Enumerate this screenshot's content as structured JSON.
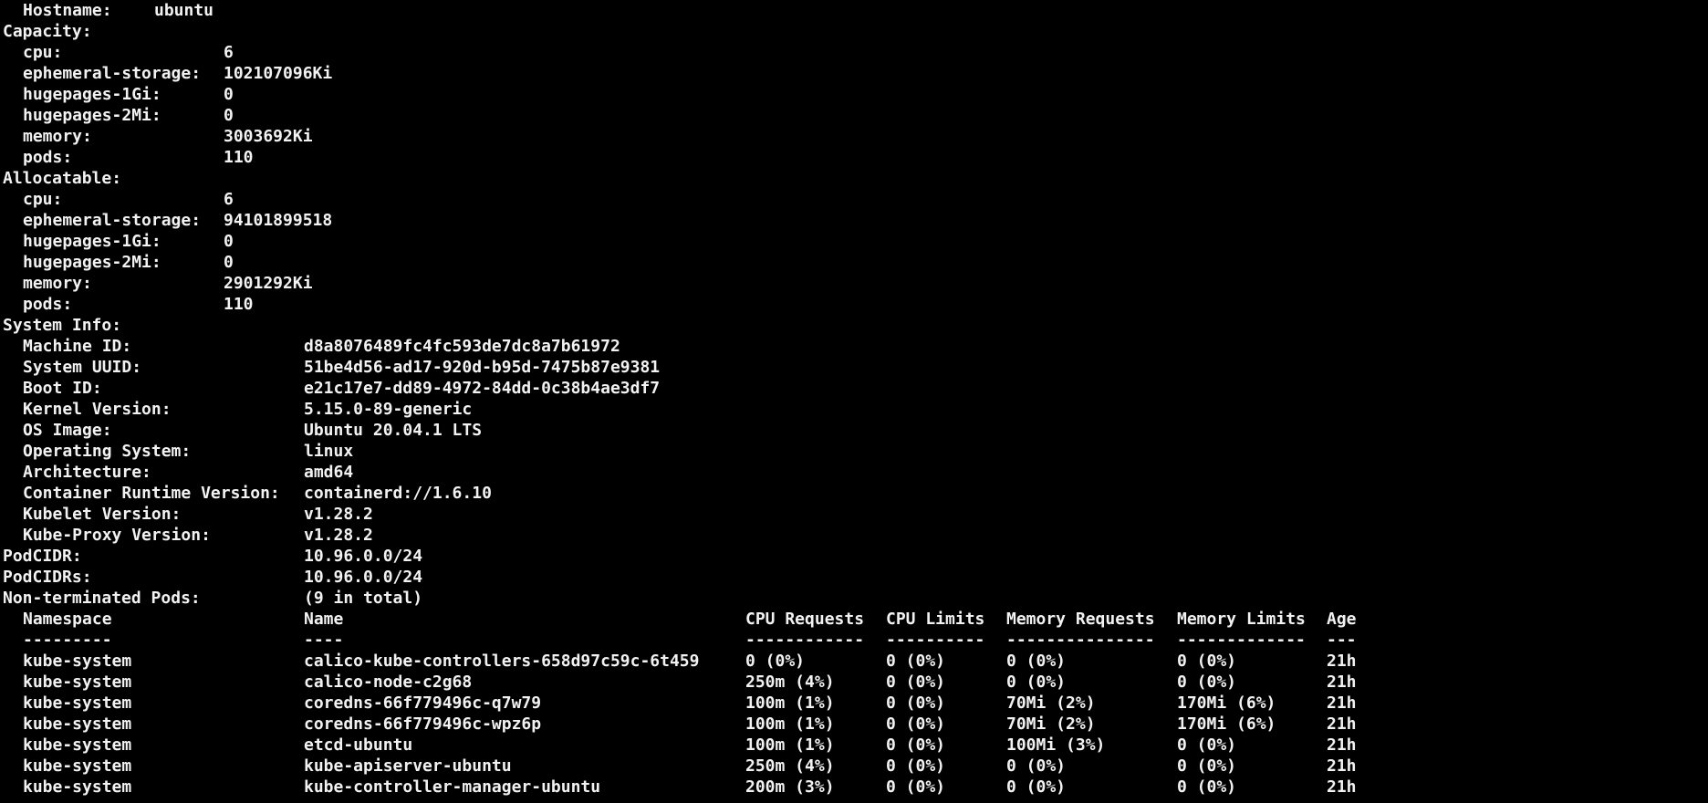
{
  "hostname": {
    "label": "Hostname:",
    "value": "ubuntu"
  },
  "capacity": {
    "header": "Capacity:",
    "items": [
      {
        "key": "cpu:",
        "value": "6"
      },
      {
        "key": "ephemeral-storage:",
        "value": "102107096Ki"
      },
      {
        "key": "hugepages-1Gi:",
        "value": "0"
      },
      {
        "key": "hugepages-2Mi:",
        "value": "0"
      },
      {
        "key": "memory:",
        "value": "3003692Ki"
      },
      {
        "key": "pods:",
        "value": "110"
      }
    ]
  },
  "allocatable": {
    "header": "Allocatable:",
    "items": [
      {
        "key": "cpu:",
        "value": "6"
      },
      {
        "key": "ephemeral-storage:",
        "value": "94101899518"
      },
      {
        "key": "hugepages-1Gi:",
        "value": "0"
      },
      {
        "key": "hugepages-2Mi:",
        "value": "0"
      },
      {
        "key": "memory:",
        "value": "2901292Ki"
      },
      {
        "key": "pods:",
        "value": "110"
      }
    ]
  },
  "system_info": {
    "header": "System Info:",
    "items": [
      {
        "key": "Machine ID:",
        "value": "d8a8076489fc4fc593de7dc8a7b61972"
      },
      {
        "key": "System UUID:",
        "value": "51be4d56-ad17-920d-b95d-7475b87e9381"
      },
      {
        "key": "Boot ID:",
        "value": "e21c17e7-dd89-4972-84dd-0c38b4ae3df7"
      },
      {
        "key": "Kernel Version:",
        "value": "5.15.0-89-generic"
      },
      {
        "key": "OS Image:",
        "value": "Ubuntu 20.04.1 LTS"
      },
      {
        "key": "Operating System:",
        "value": "linux"
      },
      {
        "key": "Architecture:",
        "value": "amd64"
      },
      {
        "key": "Container Runtime Version:",
        "value": "containerd://1.6.10"
      },
      {
        "key": "Kubelet Version:",
        "value": "v1.28.2"
      },
      {
        "key": "Kube-Proxy Version:",
        "value": "v1.28.2"
      }
    ]
  },
  "podcidr": {
    "label": "PodCIDR:",
    "value": "10.96.0.0/24"
  },
  "podcidrs": {
    "label": "PodCIDRs:",
    "value": "10.96.0.0/24"
  },
  "non_terminated_pods": {
    "label": "Non-terminated Pods:",
    "value": "(9 in total)",
    "headers": [
      "Namespace",
      "Name",
      "CPU Requests",
      "CPU Limits",
      "Memory Requests",
      "Memory Limits",
      "Age"
    ],
    "separators": [
      "---------",
      "----",
      "------------",
      "----------",
      "---------------",
      "-------------",
      "---"
    ],
    "rows": [
      [
        "kube-system",
        "calico-kube-controllers-658d97c59c-6t459",
        "0 (0%)",
        "0 (0%)",
        "0 (0%)",
        "0 (0%)",
        "21h"
      ],
      [
        "kube-system",
        "calico-node-c2g68",
        "250m (4%)",
        "0 (0%)",
        "0 (0%)",
        "0 (0%)",
        "21h"
      ],
      [
        "kube-system",
        "coredns-66f779496c-q7w79",
        "100m (1%)",
        "0 (0%)",
        "70Mi (2%)",
        "170Mi (6%)",
        "21h"
      ],
      [
        "kube-system",
        "coredns-66f779496c-wpz6p",
        "100m (1%)",
        "0 (0%)",
        "70Mi (2%)",
        "170Mi (6%)",
        "21h"
      ],
      [
        "kube-system",
        "etcd-ubuntu",
        "100m (1%)",
        "0 (0%)",
        "100Mi (3%)",
        "0 (0%)",
        "21h"
      ],
      [
        "kube-system",
        "kube-apiserver-ubuntu",
        "250m (4%)",
        "0 (0%)",
        "0 (0%)",
        "0 (0%)",
        "21h"
      ],
      [
        "kube-system",
        "kube-controller-manager-ubuntu",
        "200m (3%)",
        "0 (0%)",
        "0 (0%)",
        "0 (0%)",
        "21h"
      ]
    ]
  },
  "colors": {
    "background": "#000000",
    "text": "#f2f2f2"
  }
}
